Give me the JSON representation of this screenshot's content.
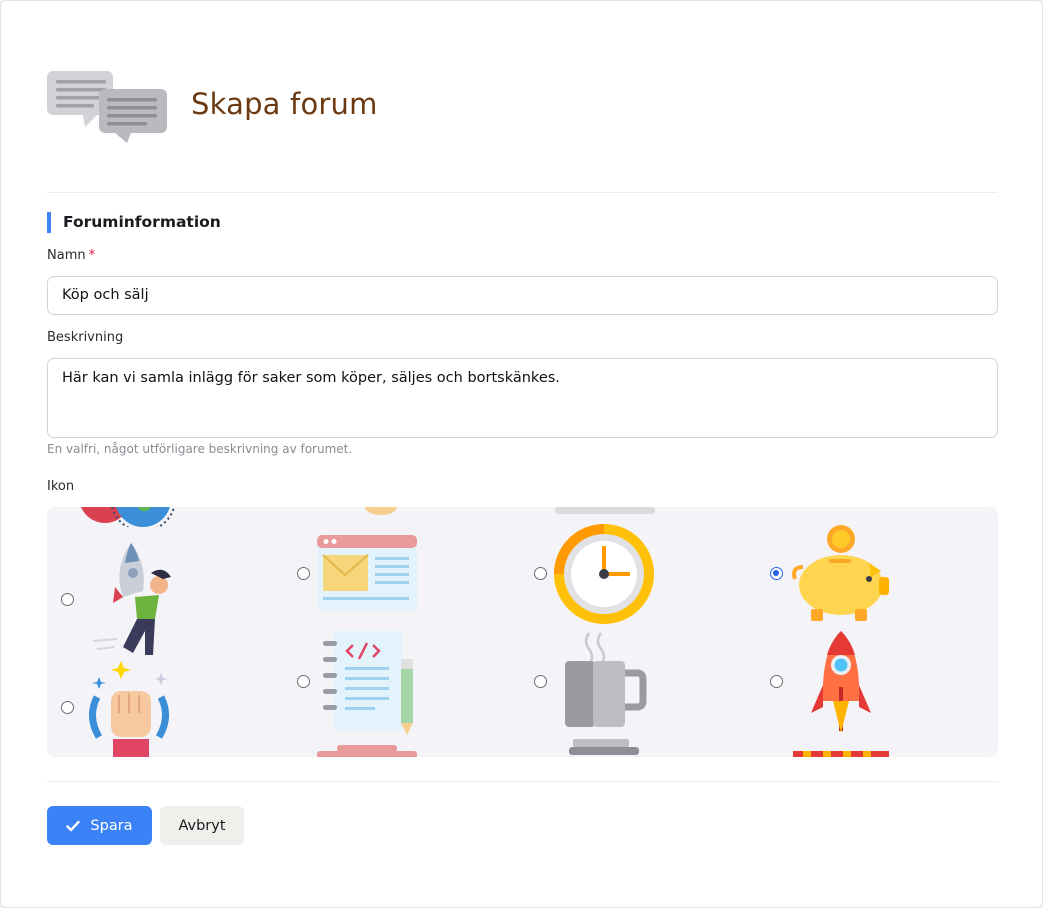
{
  "page": {
    "title": "Skapa forum"
  },
  "section": {
    "title": "Foruminformation"
  },
  "form": {
    "name_label": "Namn",
    "name_required_mark": "*",
    "name_value": "Köp och sälj",
    "description_label": "Beskrivning",
    "description_value": "Här kan vi samla inlägg för saker som köper, säljes och bortskänkes.",
    "description_hint": "En valfri, något utförligare beskrivning av forumet.",
    "icon_label": "Ikon",
    "icon_options": [
      {
        "icon": "rocket-person-icon",
        "selected": false
      },
      {
        "icon": "browser-email-icon",
        "selected": false
      },
      {
        "icon": "clock-icon",
        "selected": false
      },
      {
        "icon": "piggy-bank-icon",
        "selected": true
      },
      {
        "icon": "raised-fist-icon",
        "selected": false
      },
      {
        "icon": "code-notebook-icon",
        "selected": false
      },
      {
        "icon": "coffee-mug-icon",
        "selected": false
      },
      {
        "icon": "rocket-icon",
        "selected": false
      }
    ]
  },
  "actions": {
    "save_label": "Spara",
    "cancel_label": "Avbryt"
  },
  "colors": {
    "accent": "#3b82f6",
    "title": "#6b3a12",
    "required": "#e11d48"
  }
}
